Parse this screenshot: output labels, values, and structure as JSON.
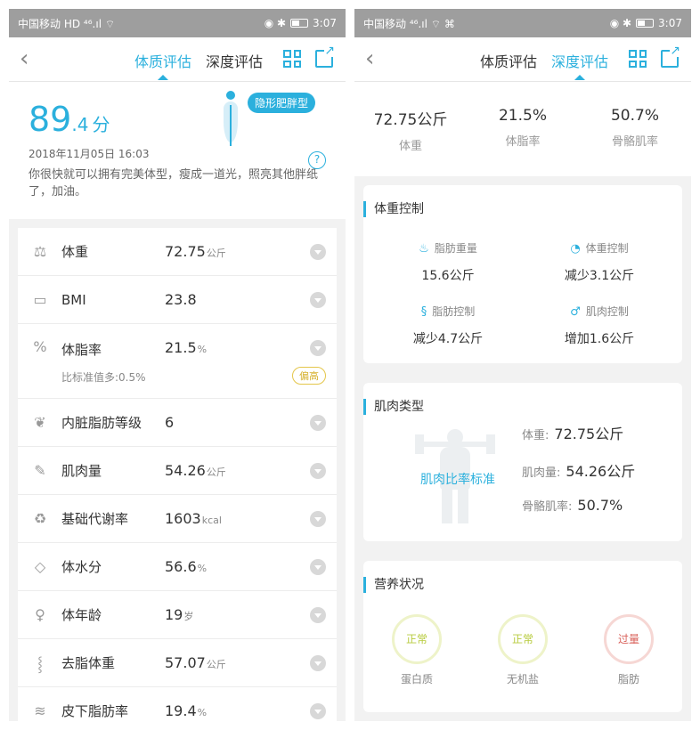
{
  "status": {
    "carrier": "中国移动",
    "signal_left": "HD ⁴⁶.ıl ⌔",
    "signal_right": "⁴⁶.ıl ⌔ ⌘",
    "icons": "◉ ✱",
    "time": "3:07"
  },
  "tabs": {
    "tab1": "体质评估",
    "tab2": "深度评估"
  },
  "left": {
    "score_int": "89",
    "score_dec": ".4",
    "score_unit": "分",
    "body_type": "隐形肥胖型",
    "datetime": "2018年11月05日 16:03",
    "message": "你很快就可以拥有完美体型，瘦成一道光，照亮其他胖纸了，加油。",
    "rows": [
      {
        "icon": "⚖",
        "name": "体重",
        "value": "72.75",
        "unit": "公斤"
      },
      {
        "icon": "▭",
        "name": "BMI",
        "value": "23.8",
        "unit": ""
      },
      {
        "icon": "%",
        "name": "体脂率",
        "value": "21.5",
        "unit": "%",
        "sub": "比标准值多:0.5%",
        "flag": "偏高"
      },
      {
        "icon": "❦",
        "name": "内脏脂肪等级",
        "value": "6",
        "unit": ""
      },
      {
        "icon": "✎",
        "name": "肌肉量",
        "value": "54.26",
        "unit": "公斤"
      },
      {
        "icon": "♻",
        "name": "基础代谢率",
        "value": "1603",
        "unit": "kcal"
      },
      {
        "icon": "◇",
        "name": "体水分",
        "value": "56.6",
        "unit": "%"
      },
      {
        "icon": "♀",
        "name": "体年龄",
        "value": "19",
        "unit": "岁"
      },
      {
        "icon": "⸾",
        "name": "去脂体重",
        "value": "57.07",
        "unit": "公斤"
      },
      {
        "icon": "≋",
        "name": "皮下脂肪率",
        "value": "19.4",
        "unit": "%"
      }
    ]
  },
  "right": {
    "stats": [
      {
        "value": "72.75公斤",
        "label": "体重"
      },
      {
        "value": "21.5%",
        "label": "体脂率"
      },
      {
        "value": "50.7%",
        "label": "骨骼肌率"
      }
    ],
    "weight_control": {
      "title": "体重控制",
      "items": [
        {
          "icon": "♨",
          "label": "脂肪重量",
          "value": "15.6公斤"
        },
        {
          "icon": "◔",
          "label": "体重控制",
          "value": "减少3.1公斤"
        },
        {
          "icon": "§",
          "label": "脂肪控制",
          "value": "减少4.7公斤"
        },
        {
          "icon": "♂",
          "label": "肌肉控制",
          "value": "增加1.6公斤"
        }
      ]
    },
    "muscle_type": {
      "title": "肌肉类型",
      "standard": "肌肉比率标准",
      "lines": [
        {
          "label": "体重:",
          "value": "72.75公斤"
        },
        {
          "label": "肌肉量:",
          "value": "54.26公斤"
        },
        {
          "label": "骨骼肌率:",
          "value": "50.7%"
        }
      ]
    },
    "nutrition": {
      "title": "营养状况",
      "items": [
        {
          "status": "正常",
          "label": "蛋白质"
        },
        {
          "status": "正常",
          "label": "无机盐"
        },
        {
          "status": "过量",
          "label": "脂肪"
        }
      ]
    }
  }
}
